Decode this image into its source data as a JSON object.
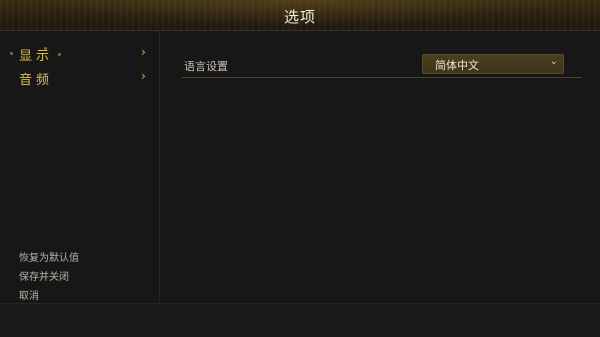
{
  "header": {
    "title": "选项"
  },
  "sidebar": {
    "items": [
      {
        "label": "显示",
        "chevron": "›"
      },
      {
        "label": "音频",
        "chevron": "›"
      }
    ],
    "actions": [
      {
        "label": "恢复为默认值"
      },
      {
        "label": "保存并关闭"
      },
      {
        "label": "取消"
      }
    ]
  },
  "settings": {
    "language": {
      "label": "语言设置",
      "value": "简体中文",
      "caret": "⌄"
    }
  },
  "colors": {
    "accent_gold": "#e0bf3a",
    "title_bar": "#2a2110",
    "background": "#171717",
    "select_bg": "#4b3f22"
  }
}
